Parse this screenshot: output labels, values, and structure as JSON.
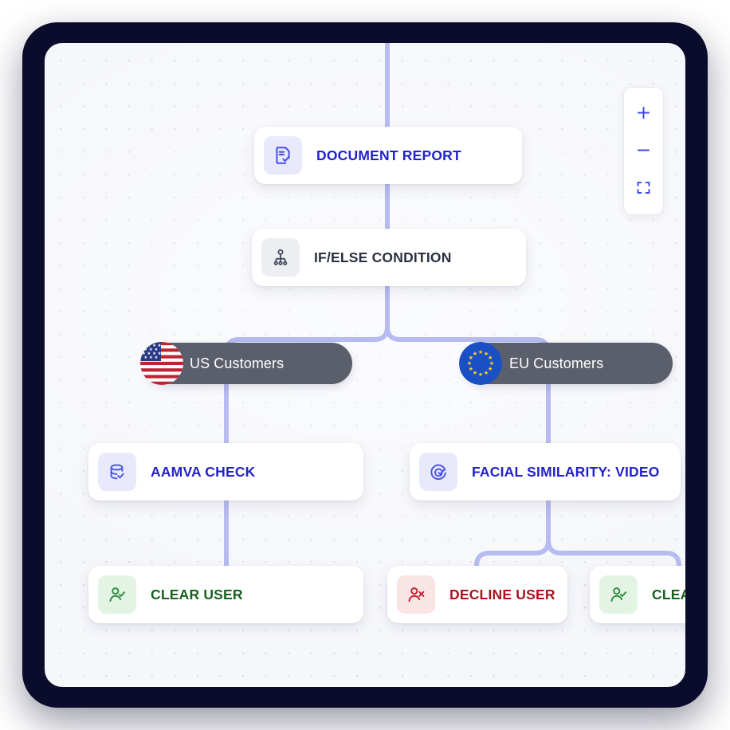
{
  "canvas": {
    "background_color": "#f6f7fb",
    "frame_color": "#0b0c2c",
    "grid": "dotted",
    "connector_color": "#b6bbf0"
  },
  "zoom_controls": {
    "zoom_in_label": "+",
    "zoom_out_label": "−",
    "fit_label": "fit-to-screen",
    "icons": [
      "plus-icon",
      "minus-icon",
      "fit-screen-icon"
    ],
    "accent_color": "#3b47e8"
  },
  "nodes": [
    {
      "id": "document-report",
      "label": "DOCUMENT REPORT",
      "icon": "document-check-icon",
      "icon_style": "icon-blue",
      "label_style": "label-blue"
    },
    {
      "id": "if-else-condition",
      "label": "IF/ELSE CONDITION",
      "icon": "branch-condition-icon",
      "icon_style": "icon-gray",
      "label_style": "label-dark"
    },
    {
      "id": "aamva-check",
      "label": "AAMVA CHECK",
      "icon": "database-check-icon",
      "icon_style": "icon-blue",
      "label_style": "label-blue"
    },
    {
      "id": "facial-similarity-video",
      "label": "FACIAL SIMILARITY: VIDEO",
      "icon": "face-scan-icon",
      "icon_style": "icon-blue",
      "label_style": "label-blue"
    },
    {
      "id": "clear-user-left",
      "label": "CLEAR USER",
      "icon": "user-check-icon",
      "icon_style": "icon-green",
      "label_style": "label-green"
    },
    {
      "id": "decline-user",
      "label": "DECLINE USER",
      "icon": "user-x-icon",
      "icon_style": "icon-red",
      "label_style": "label-red"
    },
    {
      "id": "clear-user-right",
      "label": "CLEAR USER",
      "icon": "user-check-icon",
      "icon_style": "icon-green",
      "label_style": "label-green"
    }
  ],
  "branches": [
    {
      "id": "us-customers",
      "label": "US Customers",
      "flag": "us-flag-icon"
    },
    {
      "id": "eu-customers",
      "label": "EU Customers",
      "flag": "eu-flag-icon"
    }
  ]
}
